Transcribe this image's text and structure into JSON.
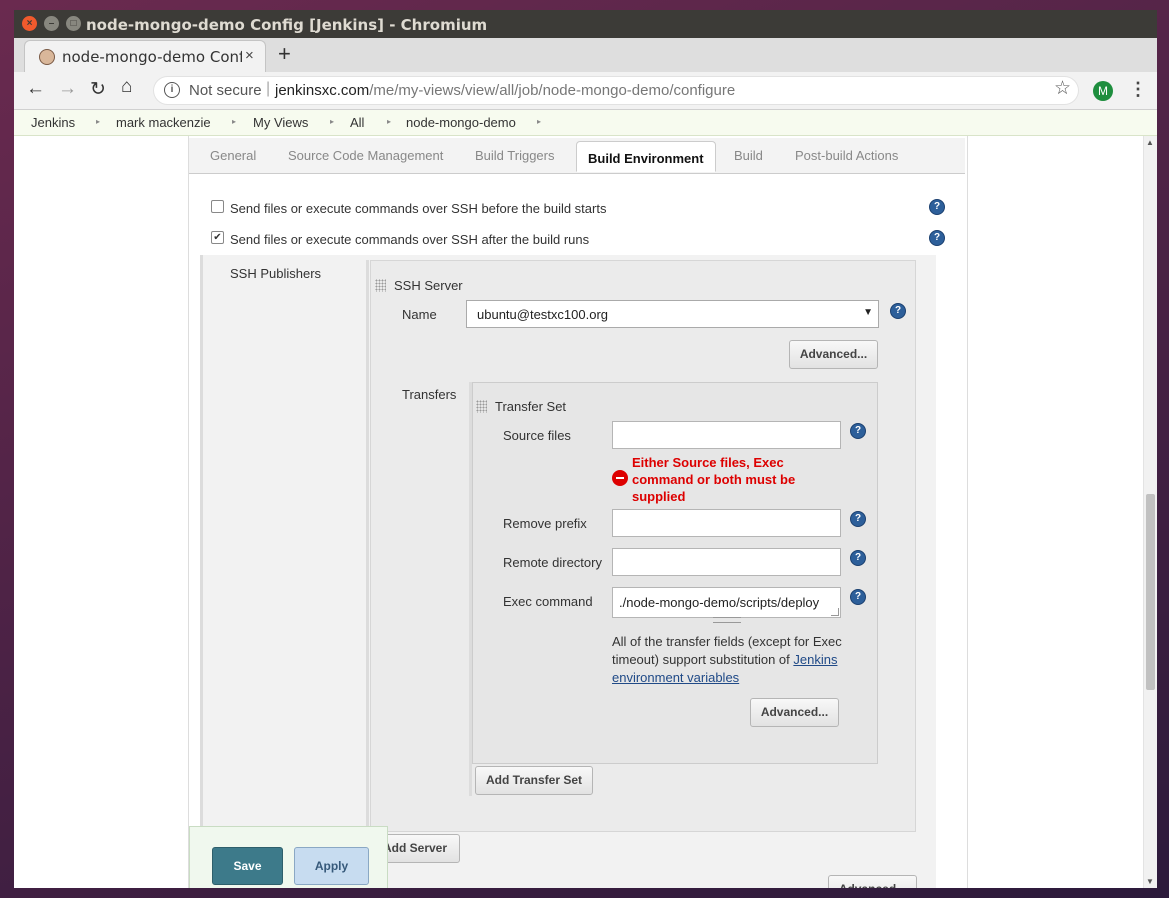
{
  "window": {
    "title": "node-mongo-demo Config [Jenkins] - Chromium",
    "close_glyph": "×",
    "min_glyph": "–",
    "max_glyph": "□"
  },
  "browser": {
    "tab_title": "node-mongo-demo Config [Jenkins]",
    "tab_close": "×",
    "new_tab": "+",
    "back": "←",
    "forward": "→",
    "reload": "↻",
    "home": "⌂",
    "security_label": "Not secure",
    "url_host": "jenkinsxc.com",
    "url_path": "/me/my-views/view/all/job/node-mongo-demo/configure",
    "star": "☆",
    "profile_initial": "M",
    "menu": "⋮"
  },
  "breadcrumbs": [
    "Jenkins",
    "mark mackenzie",
    "My Views",
    "All",
    "node-mongo-demo"
  ],
  "breadcrumb_arrow": "▸",
  "config_tabs": [
    "General",
    "Source Code Management",
    "Build Triggers",
    "Build Environment",
    "Build",
    "Post-build Actions"
  ],
  "active_tab": "Build Environment",
  "build_env": {
    "ssh_before_label": "Send files or execute commands over SSH before the build starts",
    "ssh_before_checked": false,
    "ssh_after_label": "Send files or execute commands over SSH after the build runs",
    "ssh_after_checked": true,
    "check_glyph": "✔",
    "ssh_publishers_label": "SSH Publishers"
  },
  "ssh_server": {
    "heading": "SSH Server",
    "name_label": "Name",
    "name_value": "ubuntu@testxc100.org",
    "dropdown_arrow": "▼",
    "advanced_button": "Advanced...",
    "transfers_label": "Transfers"
  },
  "transfer_set": {
    "heading": "Transfer Set",
    "source_files_label": "Source files",
    "source_files_value": "",
    "error_message": "Either Source files, Exec command or both must be supplied",
    "remove_prefix_label": "Remove prefix",
    "remove_prefix_value": "",
    "remote_directory_label": "Remote directory",
    "remote_directory_value": "",
    "exec_command_label": "Exec command",
    "exec_command_value": "./node-mongo-demo/scripts/deploy",
    "info_text": "All of the transfer fields (except for Exec timeout) support substitution of ",
    "info_link": "Jenkins environment variables",
    "advanced_button": "Advanced..."
  },
  "buttons": {
    "add_transfer_set": "Add Transfer Set",
    "add_server": "Add Server",
    "advanced": "Advanced...",
    "save": "Save",
    "apply": "Apply"
  },
  "help_glyph": "?",
  "scroll": {
    "up": "▲",
    "down": "▼"
  }
}
